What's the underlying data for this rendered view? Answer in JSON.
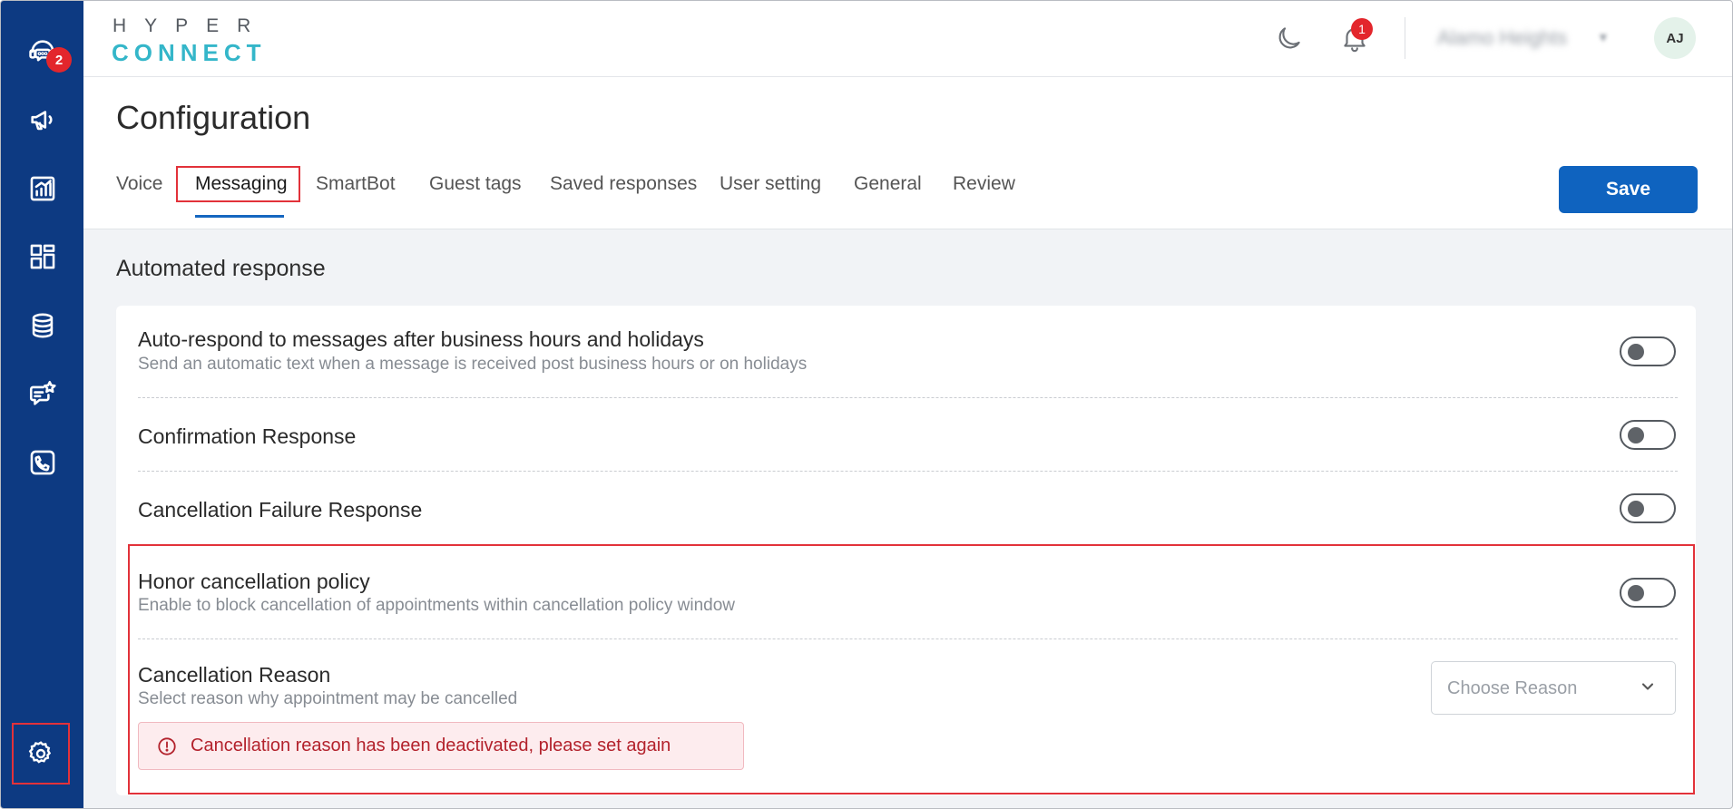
{
  "app": {
    "logo_top": "HYPER",
    "logo_bottom": "CONNECT",
    "sidebar": {
      "items": [
        {
          "icon": "chat-support-icon",
          "badge": "2"
        },
        {
          "icon": "megaphone-icon"
        },
        {
          "icon": "report-chart-icon"
        },
        {
          "icon": "dashboard-grid-icon"
        },
        {
          "icon": "database-icon"
        },
        {
          "icon": "chat-star-icon"
        },
        {
          "icon": "phone-icon"
        },
        {
          "icon": "gear-icon"
        }
      ]
    },
    "header": {
      "notification_count": "1",
      "account_name": "Alamo Heights",
      "avatar_initials": "AJ"
    }
  },
  "page": {
    "title": "Configuration",
    "tabs": [
      "Voice",
      "Messaging",
      "SmartBot",
      "Guest tags",
      "Saved responses",
      "User setting",
      "General",
      "Review"
    ],
    "active_tab": "Messaging",
    "save_label": "Save"
  },
  "section": {
    "title": "Automated response",
    "rows": [
      {
        "title": "Auto-respond to messages after business hours and holidays",
        "desc": "Send an automatic text when a message is received post business hours or on holidays",
        "enabled": false
      },
      {
        "title": "Confirmation Response",
        "enabled": false
      },
      {
        "title": "Cancellation Failure Response",
        "enabled": false
      },
      {
        "title": "Honor cancellation policy",
        "desc": "Enable to block cancellation of appointments within cancellation policy window",
        "enabled": false
      }
    ],
    "cancellation_reason": {
      "title": "Cancellation Reason",
      "desc": "Select reason why appointment may be cancelled",
      "placeholder": "Choose Reason",
      "error": "Cancellation reason has been deactivated, please set again"
    }
  },
  "colors": {
    "sidebar": "#0d3a82",
    "accent": "#0f63bf",
    "highlight": "#e2323a",
    "error_bg": "#fdecee",
    "error_text": "#b3222c"
  }
}
